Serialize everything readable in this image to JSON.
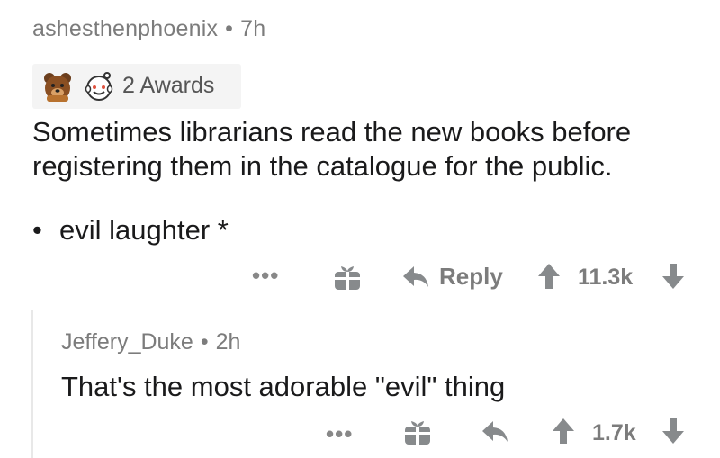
{
  "comment": {
    "username": "ashesthenphoenix",
    "separator": "•",
    "age": "7h",
    "awards_label": "2 Awards",
    "award_icons": [
      "bear-award-icon",
      "wholesome-award-icon"
    ],
    "body": "Sometimes librarians read the new books before registering them in the catalogue for the public.",
    "bullet_mark": "•",
    "bullet_text": "evil laughter *",
    "actions": {
      "more": "•••",
      "reply_label": "Reply",
      "score": "11.3k"
    }
  },
  "reply": {
    "username": "Jeffery_Duke",
    "separator": "•",
    "age": "2h",
    "body": "That's the most adorable \"evil\" thing",
    "actions": {
      "more": "•••",
      "score": "1.7k"
    }
  },
  "colors": {
    "meta_text": "#7c7c7c",
    "body_text": "#1a1a1b",
    "icon": "#878a8c",
    "award_bg": "#f4f4f4"
  }
}
